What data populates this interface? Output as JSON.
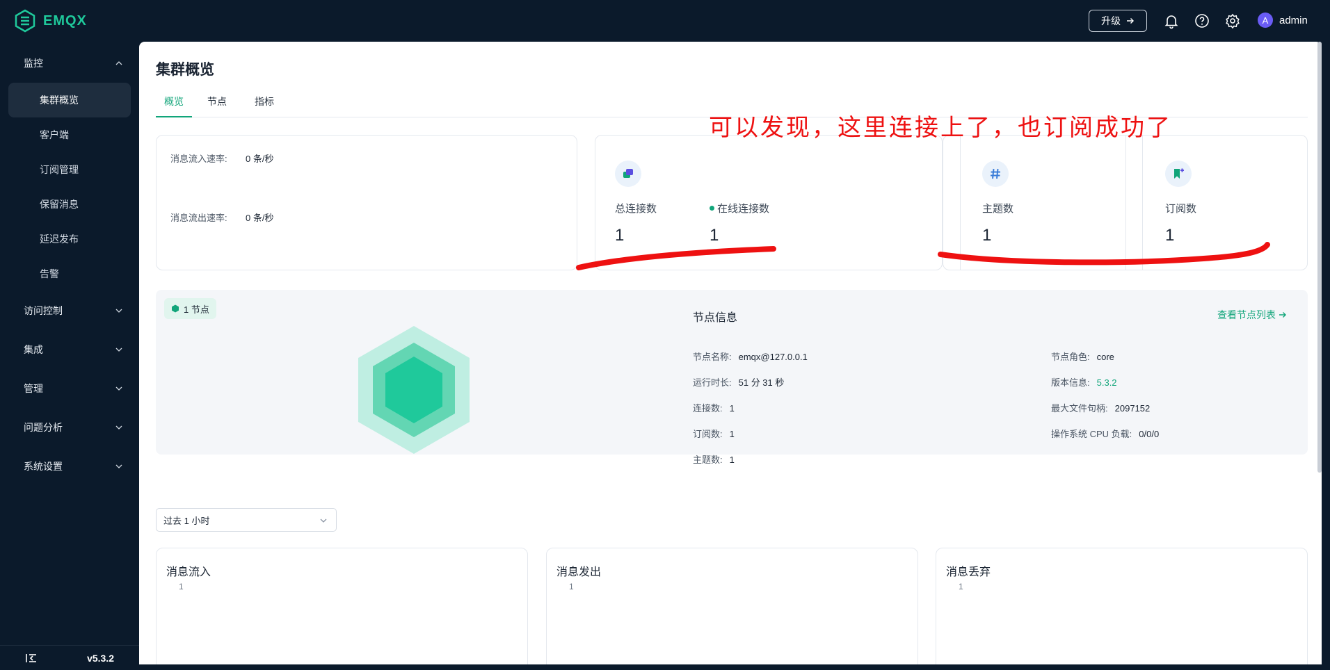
{
  "app": {
    "logo_text": "EMQX",
    "version": "v5.3.2"
  },
  "topbar": {
    "upgrade_label": "升级",
    "user_initial": "A",
    "username": "admin"
  },
  "sidebar": {
    "groups": [
      {
        "label": "监控",
        "expanded": true
      },
      {
        "label": "访问控制",
        "expanded": false
      },
      {
        "label": "集成",
        "expanded": false
      },
      {
        "label": "管理",
        "expanded": false
      },
      {
        "label": "问题分析",
        "expanded": false
      },
      {
        "label": "系统设置",
        "expanded": false
      }
    ],
    "items": [
      {
        "label": "集群概览",
        "active": true
      },
      {
        "label": "客户端"
      },
      {
        "label": "订阅管理"
      },
      {
        "label": "保留消息"
      },
      {
        "label": "延迟发布"
      },
      {
        "label": "告警"
      }
    ]
  },
  "page": {
    "title": "集群概览",
    "tabs": [
      {
        "label": "概览",
        "active": true
      },
      {
        "label": "节点"
      },
      {
        "label": "指标"
      }
    ]
  },
  "rates": {
    "in_label": "消息流入速率:",
    "in_value": "0 条/秒",
    "out_label": "消息流出速率:",
    "out_value": "0 条/秒"
  },
  "stats": {
    "total_connections": {
      "label": "总连接数",
      "value": "1"
    },
    "online_connections": {
      "label": "在线连接数",
      "value": "1"
    },
    "topics": {
      "label": "主题数",
      "value": "1"
    },
    "subscriptions": {
      "label": "订阅数",
      "value": "1"
    }
  },
  "annotation": "可以发现，这里连接上了，也订阅成功了",
  "node": {
    "badge": "1 节点",
    "section_title": "节点信息",
    "view_list_link": "查看节点列表",
    "left_fields": [
      {
        "label": "节点名称:",
        "value": "emqx@127.0.0.1"
      },
      {
        "label": "运行时长:",
        "value": "51 分 31 秒"
      },
      {
        "label": "连接数:",
        "value": "1"
      },
      {
        "label": "订阅数:",
        "value": "1"
      },
      {
        "label": "主题数:",
        "value": "1"
      }
    ],
    "right_fields": [
      {
        "label": "节点角色:",
        "value": "core"
      },
      {
        "label": "版本信息:",
        "value": "5.3.2"
      },
      {
        "label": "最大文件句柄:",
        "value": "2097152"
      },
      {
        "label": "操作系统 CPU 负载:",
        "value": "0/0/0"
      }
    ]
  },
  "time_range": {
    "selected": "过去 1 小时"
  },
  "charts": [
    {
      "title": "消息流入",
      "tick": "1"
    },
    {
      "title": "消息发出",
      "tick": "1"
    },
    {
      "title": "消息丢弃",
      "tick": "1"
    }
  ],
  "colors": {
    "accent": "#11a57a",
    "sidebar_bg": "#0b1a2b",
    "annotation": "#ee1111"
  }
}
